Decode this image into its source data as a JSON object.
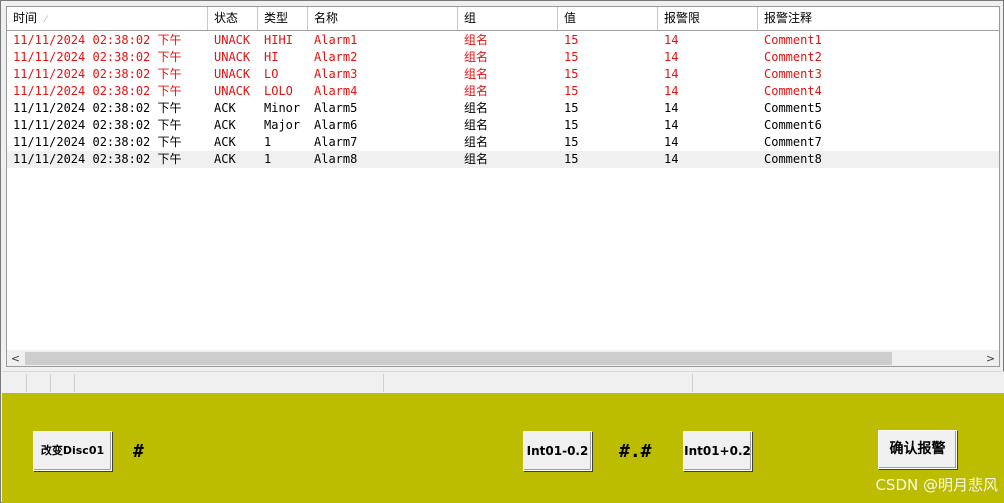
{
  "alarm_grid": {
    "columns": [
      {
        "key": "time",
        "label": "时间"
      },
      {
        "key": "state",
        "label": "状态"
      },
      {
        "key": "type",
        "label": "类型"
      },
      {
        "key": "name",
        "label": "名称"
      },
      {
        "key": "group",
        "label": "组"
      },
      {
        "key": "value",
        "label": "值"
      },
      {
        "key": "limit",
        "label": "报警限"
      },
      {
        "key": "comment",
        "label": "报警注释"
      }
    ],
    "rows": [
      {
        "time": "11/11/2024 02:38:02 下午",
        "state": "UNACK",
        "type": "HIHI",
        "name": "Alarm1",
        "group": "组名",
        "value": "15",
        "limit": "14",
        "comment": "Comment1"
      },
      {
        "time": "11/11/2024 02:38:02 下午",
        "state": "UNACK",
        "type": "HI",
        "name": "Alarm2",
        "group": "组名",
        "value": "15",
        "limit": "14",
        "comment": "Comment2"
      },
      {
        "time": "11/11/2024 02:38:02 下午",
        "state": "UNACK",
        "type": "LO",
        "name": "Alarm3",
        "group": "组名",
        "value": "15",
        "limit": "14",
        "comment": "Comment3"
      },
      {
        "time": "11/11/2024 02:38:02 下午",
        "state": "UNACK",
        "type": "LOLO",
        "name": "Alarm4",
        "group": "组名",
        "value": "15",
        "limit": "14",
        "comment": "Comment4"
      },
      {
        "time": "11/11/2024 02:38:02 下午",
        "state": "ACK",
        "type": "Minor",
        "name": "Alarm5",
        "group": "组名",
        "value": "15",
        "limit": "14",
        "comment": "Comment5"
      },
      {
        "time": "11/11/2024 02:38:02 下午",
        "state": "ACK",
        "type": "Major",
        "name": "Alarm6",
        "group": "组名",
        "value": "15",
        "limit": "14",
        "comment": "Comment6"
      },
      {
        "time": "11/11/2024 02:38:02 下午",
        "state": "ACK",
        "type": "1",
        "name": "Alarm7",
        "group": "组名",
        "value": "15",
        "limit": "14",
        "comment": "Comment7"
      },
      {
        "time": "11/11/2024 02:38:02 下午",
        "state": "ACK",
        "type": "1",
        "name": "Alarm8",
        "group": "组名",
        "value": "15",
        "limit": "14",
        "comment": "Comment8"
      }
    ],
    "selected_row": 7,
    "unack_color": "#e81010",
    "ack_color": "#000000"
  },
  "scrollbar": {
    "left_arrow": "<",
    "right_arrow": ">"
  },
  "panel": {
    "background": "#bcbc00",
    "change_disc_label": "改变Disc01",
    "disc_display": "#",
    "int_minus_label": "Int01-0.2",
    "int_display": "#.#",
    "int_plus_label": "Int01+0.2",
    "ack_alarm_label": "确认报警"
  },
  "watermark": "CSDN @明月悲风"
}
